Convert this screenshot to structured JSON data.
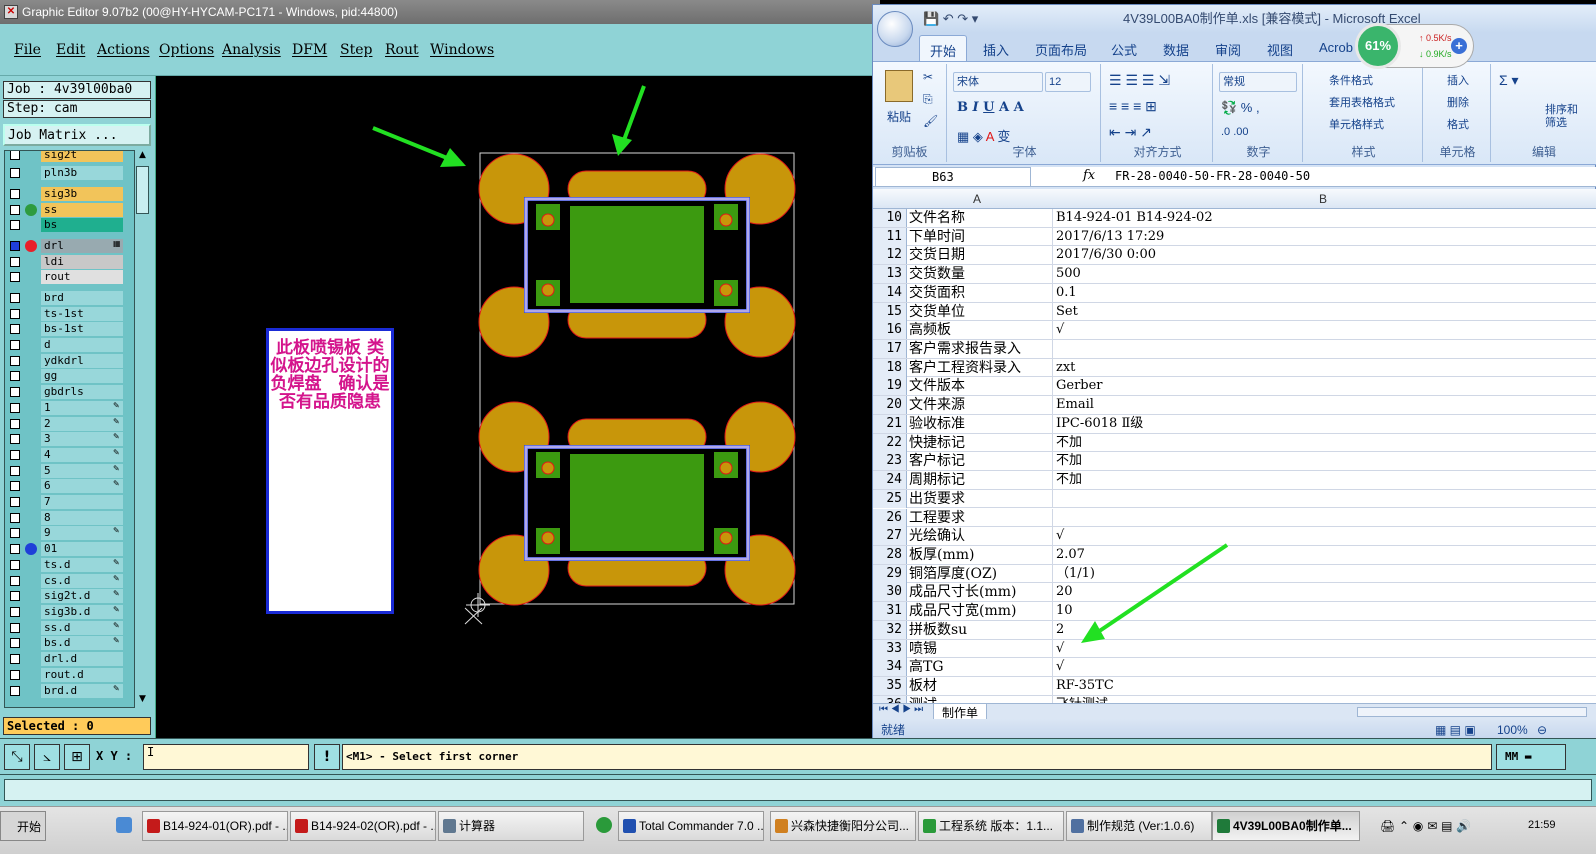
{
  "graphic_editor": {
    "title": "Graphic Editor 9.07b2 (00@HY-HYCAM-PC171 - Windows, pid:44800)",
    "menu": [
      "File",
      "Edit",
      "Actions",
      "Options",
      "Analysis",
      "DFM",
      "Step",
      "Rout",
      "Windows"
    ],
    "job": "Job : 4v39l00ba0",
    "step": "Step: cam",
    "job_matrix_button": "Job Matrix ...",
    "layers": [
      {
        "name": "sig2t",
        "color": "#f2c45a",
        "dot": null,
        "flag": ""
      },
      {
        "name": "pln3b",
        "color": "#98d7da",
        "dot": null,
        "flag": ""
      },
      {
        "name": "sig3b",
        "color": "#f2c45a",
        "dot": null,
        "flag": ""
      },
      {
        "name": "ss",
        "color": "#f2c45a",
        "dot": "#2e9b3e",
        "flag": ""
      },
      {
        "name": "bs",
        "color": "#1faf8f",
        "dot": null,
        "flag": ""
      },
      {
        "name": "drl",
        "color": "#98aab0",
        "dot": "#e8202a",
        "flag": "m"
      },
      {
        "name": "ldi",
        "color": "#c8c8c8",
        "dot": null,
        "flag": ""
      },
      {
        "name": "rout",
        "color": "#e0e0e0",
        "dot": null,
        "flag": ""
      },
      {
        "name": "brd",
        "color": "#98d7da",
        "dot": null,
        "flag": ""
      },
      {
        "name": "ts-1st",
        "color": "#98d7da",
        "dot": null,
        "flag": ""
      },
      {
        "name": "bs-1st",
        "color": "#98d7da",
        "dot": null,
        "flag": ""
      },
      {
        "name": "d",
        "color": "#98d7da",
        "dot": null,
        "flag": ""
      },
      {
        "name": "ydkdrl",
        "color": "#98d7da",
        "dot": null,
        "flag": ""
      },
      {
        "name": "gg",
        "color": "#98d7da",
        "dot": null,
        "flag": ""
      },
      {
        "name": "gbdrls",
        "color": "#98d7da",
        "dot": null,
        "flag": ""
      },
      {
        "name": "1",
        "color": "#98d7da",
        "dot": null,
        "flag": "e"
      },
      {
        "name": "2",
        "color": "#98d7da",
        "dot": null,
        "flag": "e"
      },
      {
        "name": "3",
        "color": "#98d7da",
        "dot": null,
        "flag": "e"
      },
      {
        "name": "4",
        "color": "#98d7da",
        "dot": null,
        "flag": "e"
      },
      {
        "name": "5",
        "color": "#98d7da",
        "dot": null,
        "flag": "e"
      },
      {
        "name": "6",
        "color": "#98d7da",
        "dot": null,
        "flag": "e"
      },
      {
        "name": "7",
        "color": "#98d7da",
        "dot": null,
        "flag": ""
      },
      {
        "name": "8",
        "color": "#98d7da",
        "dot": null,
        "flag": ""
      },
      {
        "name": "9",
        "color": "#98d7da",
        "dot": null,
        "flag": "e"
      },
      {
        "name": "01",
        "color": "#98d7da",
        "dot": "#1f3fd8",
        "flag": ""
      },
      {
        "name": "ts.d",
        "color": "#98d7da",
        "dot": null,
        "flag": "e"
      },
      {
        "name": "cs.d",
        "color": "#98d7da",
        "dot": null,
        "flag": "e"
      },
      {
        "name": "sig2t.d",
        "color": "#98d7da",
        "dot": null,
        "flag": "e"
      },
      {
        "name": "sig3b.d",
        "color": "#98d7da",
        "dot": null,
        "flag": "e"
      },
      {
        "name": "ss.d",
        "color": "#98d7da",
        "dot": null,
        "flag": "e"
      },
      {
        "name": "bs.d",
        "color": "#98d7da",
        "dot": null,
        "flag": "e"
      },
      {
        "name": "drl.d",
        "color": "#98d7da",
        "dot": null,
        "flag": ""
      },
      {
        "name": "rout.d",
        "color": "#98d7da",
        "dot": null,
        "flag": ""
      },
      {
        "name": "brd.d",
        "color": "#98d7da",
        "dot": null,
        "flag": "e"
      }
    ],
    "selected": "Selected : 0",
    "note_text": "此板喷锡板 类似板边孔设计的负焊盘　确认是否有品质隐患",
    "xy_label": "X Y :",
    "xy_value": "I",
    "status_icon": "!",
    "status_message": "<M1> - Select first corner",
    "units": "MM",
    "colors": {
      "pad": "#c8960a",
      "pad_outline": "#e01818",
      "copper": "#3c9a10",
      "outline_blue": "#1a3ad8",
      "outline_lilac": "#b0a8e8",
      "arrow": "#22e022"
    }
  },
  "excel": {
    "title": "4V39L00BA0制作单.xls  [兼容模式] - Microsoft Excel",
    "tabs": [
      "开始",
      "插入",
      "页面布局",
      "公式",
      "数据",
      "审阅",
      "视图",
      "Acrob"
    ],
    "ribbon": {
      "paste": "粘贴",
      "font_name": "宋体",
      "font_size": "12",
      "number_format": "常规",
      "cond_format": "条件格式",
      "table_format": "套用表格格式",
      "cell_style": "单元格样式",
      "insert": "插入",
      "delete": "删除",
      "format": "格式",
      "sort_filter": "排序和\n筛选",
      "groups": [
        "剪贴板",
        "字体",
        "对齐方式",
        "数字",
        "样式",
        "单元格",
        "编辑"
      ]
    },
    "name_box": "B63",
    "fx": "fx",
    "formula": "FR-28-0040-50-FR-28-0040-50",
    "col_a": "A",
    "col_b": "B",
    "rows": [
      {
        "n": "10",
        "a": "文件名称",
        "b": "B14-924-01 B14-924-02"
      },
      {
        "n": "11",
        "a": "下单时间",
        "b": "2017/6/13 17:29"
      },
      {
        "n": "12",
        "a": "交货日期",
        "b": "2017/6/30 0:00"
      },
      {
        "n": "13",
        "a": "交货数量",
        "b": "500"
      },
      {
        "n": "14",
        "a": "交货面积",
        "b": "0.1"
      },
      {
        "n": "15",
        "a": "交货单位",
        "b": "Set"
      },
      {
        "n": "16",
        "a": "高频板",
        "b": "√"
      },
      {
        "n": "17",
        "a": "客户需求报告录入",
        "b": ""
      },
      {
        "n": "18",
        "a": "客户工程资料录入",
        "b": "zxt"
      },
      {
        "n": "19",
        "a": "文件版本",
        "b": "Gerber"
      },
      {
        "n": "20",
        "a": "文件来源",
        "b": "Email"
      },
      {
        "n": "21",
        "a": "验收标准",
        "b": "IPC-6018 Ⅱ级"
      },
      {
        "n": "22",
        "a": "快捷标记",
        "b": "不加"
      },
      {
        "n": "23",
        "a": "客户标记",
        "b": "不加"
      },
      {
        "n": "24",
        "a": "周期标记",
        "b": "不加"
      },
      {
        "n": "25",
        "a": "出货要求",
        "b": ""
      },
      {
        "n": "26",
        "a": "工程要求",
        "b": ""
      },
      {
        "n": "27",
        "a": "光绘确认",
        "b": "√"
      },
      {
        "n": "28",
        "a": "板厚(mm)",
        "b": "2.07"
      },
      {
        "n": "29",
        "a": "铜箔厚度(OZ)",
        "b": "（1/1)"
      },
      {
        "n": "30",
        "a": "成品尺寸长(mm)",
        "b": "20"
      },
      {
        "n": "31",
        "a": "成品尺寸宽(mm)",
        "b": "10"
      },
      {
        "n": "32",
        "a": "拼板数su",
        "b": "2"
      },
      {
        "n": "33",
        "a": "喷锡",
        "b": "√"
      },
      {
        "n": "34",
        "a": "高TG",
        "b": "√"
      },
      {
        "n": "35",
        "a": "板材",
        "b": "RF-35TC"
      },
      {
        "n": "36",
        "a": "测试",
        "b": "飞针测试"
      }
    ],
    "sheet_tab": "制作单",
    "status": "就绪",
    "zoom": "100%"
  },
  "net_monitor": {
    "percent": "61%",
    "up": "0.5K/s",
    "down": "0.9K/s"
  },
  "taskbar": {
    "start": "开始",
    "tasks": [
      {
        "label": "B14-924-01(OR).pdf - ...",
        "color": "#c41a1a",
        "active": false
      },
      {
        "label": "B14-924-02(OR).pdf - ...",
        "color": "#c41a1a",
        "active": false
      },
      {
        "label": "计算器",
        "color": "#607890",
        "active": false
      },
      {
        "label": "Total Commander 7.0 ...",
        "color": "#2050b0",
        "active": false
      },
      {
        "label": "兴森快捷衡阳分公司...",
        "color": "#d08020",
        "active": false
      },
      {
        "label": "工程系统  版本：1.1...",
        "color": "#2a9a3a",
        "active": false
      },
      {
        "label": "制作规范 (Ver:1.0.6)",
        "color": "#5070a0",
        "active": false
      },
      {
        "label": "4V39L00BA0制作单...",
        "color": "#1f7a3a",
        "active": true
      }
    ],
    "clock": "21:59"
  }
}
